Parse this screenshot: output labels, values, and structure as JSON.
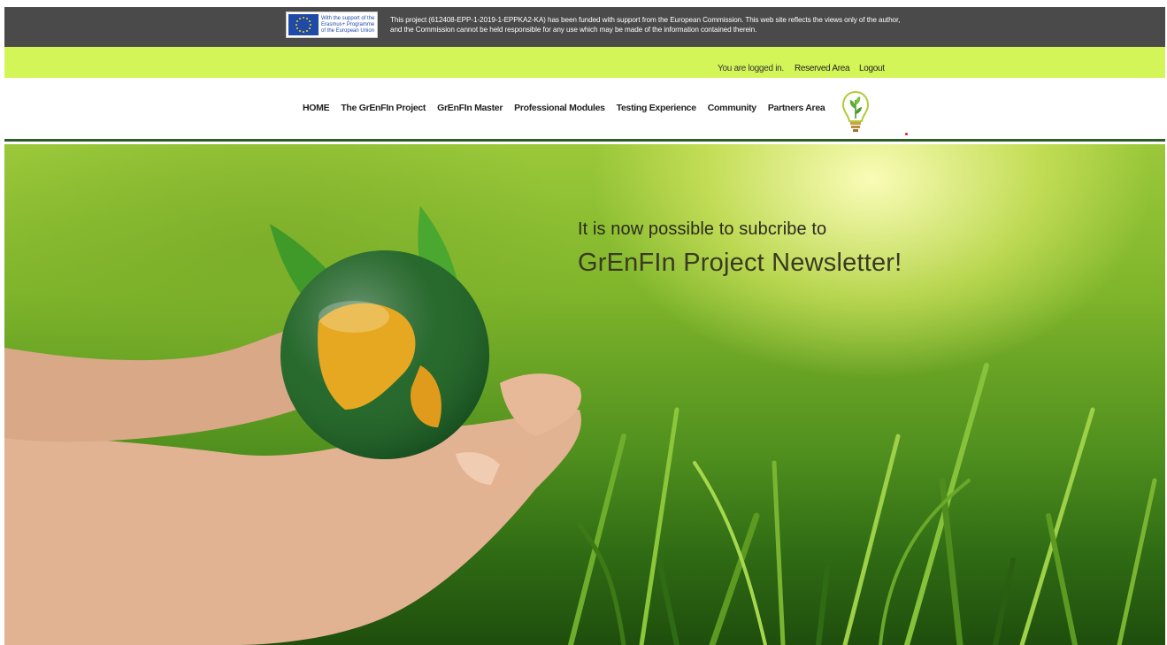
{
  "eu_notice": {
    "logo_label_lines": [
      "With the support of the",
      "Erasmus+ Programme",
      "of the European Union"
    ],
    "funding_text": "This project (612408-EPP-1-2019-1-EPPKA2-KA) has been funded with support from the European Commission. This web site reflects the views only of the author, and the Commission cannot be held responsible for any use which may be made of the information contained therein."
  },
  "userbar": {
    "status": "You are logged in.",
    "reserved_area": "Reserved Area",
    "logout": "Logout"
  },
  "nav": {
    "items": [
      {
        "label": "HOME"
      },
      {
        "label": "The GrEnFIn Project"
      },
      {
        "label": "GrEnFIn Master"
      },
      {
        "label": "Professional Modules"
      },
      {
        "label": "Testing Experience"
      },
      {
        "label": "Community"
      },
      {
        "label": "Partners Area"
      }
    ],
    "logo_icon": "lightbulb-leaf-icon"
  },
  "hero": {
    "line1": "It is now possible to subcribe to",
    "line2": "GrEnFIn Project Newsletter!",
    "image_icon": "hands-holding-globe-image"
  },
  "colors": {
    "topbar": "#4a4a4a",
    "userbar": "#d4f558",
    "nav_border": "#2f5d2a"
  }
}
